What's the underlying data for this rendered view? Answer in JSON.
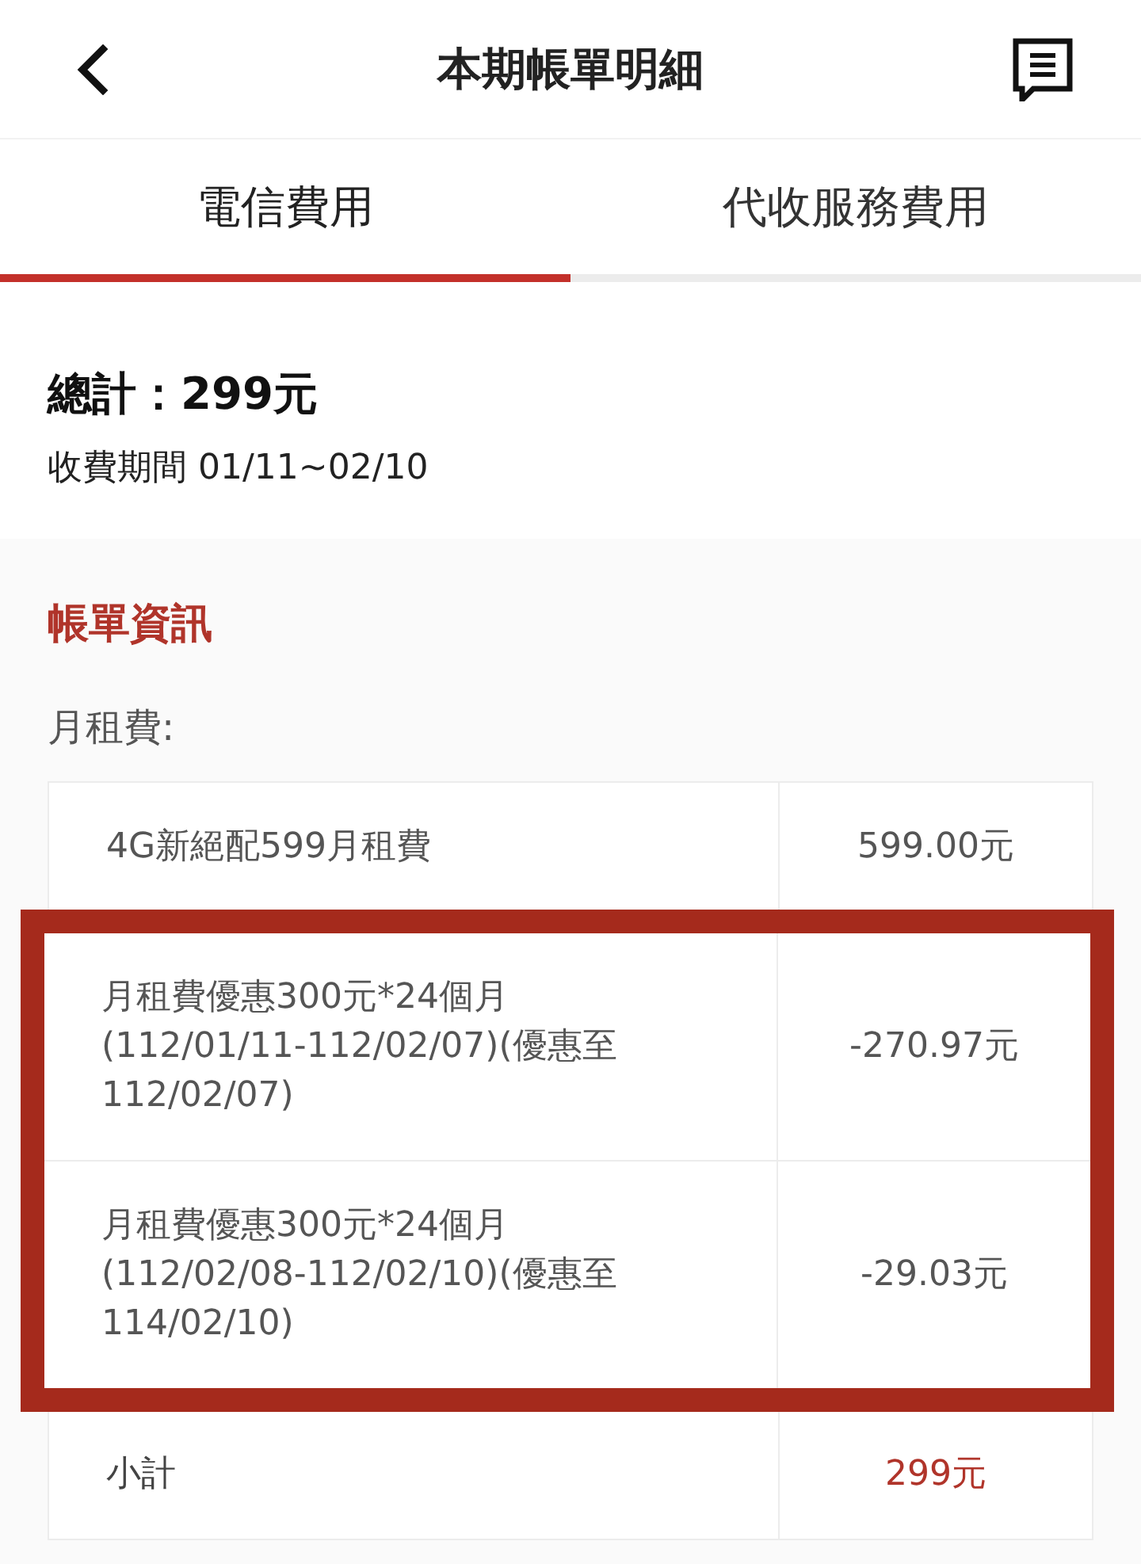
{
  "header": {
    "title": "本期帳單明細"
  },
  "tabs": [
    {
      "label": "電信費用",
      "selected": true
    },
    {
      "label": "代收服務費用",
      "selected": false
    }
  ],
  "summary": {
    "total": "總計：299元",
    "period": "收費期間 01/11~02/10"
  },
  "bill_info": {
    "title": "帳單資訊",
    "section_label": "月租費:",
    "rows": [
      {
        "kind": "charge",
        "item": "4G新絕配599月租費",
        "amount": "599.00元",
        "highlighted": false
      },
      {
        "kind": "charge",
        "item": "月租費優惠300元*24個月(112/01/11-112/02/07)(優惠至112/02/07)",
        "amount": "-270.97元",
        "highlighted": true
      },
      {
        "kind": "charge",
        "item": "月租費優惠300元*24個月(112/02/08-112/02/10)(優惠至114/02/10)",
        "amount": "-29.03元",
        "highlighted": true
      },
      {
        "kind": "subtotal",
        "item": "小計",
        "amount": "299元",
        "highlighted": false
      }
    ]
  }
}
